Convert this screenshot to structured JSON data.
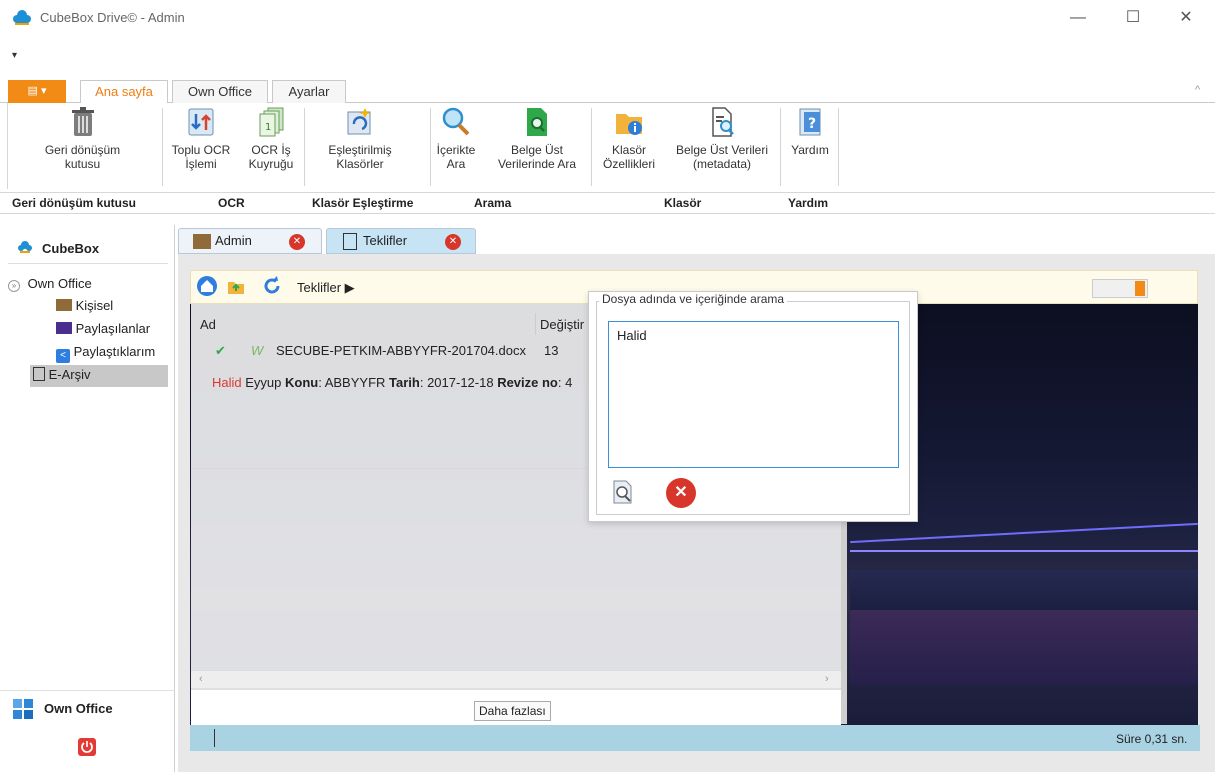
{
  "window": {
    "title": "CubeBox Drive©  -  Admin",
    "minimize": "—",
    "maximize": "☐",
    "close": "✕"
  },
  "quick_access": "▾",
  "ribbon": {
    "tabs": [
      "Ana sayfa",
      "Own Office",
      "Ayarlar"
    ],
    "active_tab": "Ana sayfa",
    "collapse": "^",
    "buttons": [
      {
        "label1": "Geri dönüşüm",
        "label2": "kutusu"
      },
      {
        "label1": "Toplu OCR",
        "label2": "İşlemi"
      },
      {
        "label1": "OCR İş",
        "label2": "Kuyruğu"
      },
      {
        "label1": "Eşleştirilmiş",
        "label2": "Klasörler"
      },
      {
        "label1": "İçerikte",
        "label2": "Ara"
      },
      {
        "label1": "Belge Üst",
        "label2": "Verilerinde Ara"
      },
      {
        "label1": "Klasör",
        "label2": "Özellikleri"
      },
      {
        "label1": "Belge Üst Verileri",
        "label2": "(metadata)"
      },
      {
        "label1": "Yardım",
        "label2": ""
      }
    ],
    "groups": [
      "Geri dönüşüm kutusu",
      "OCR",
      "Klasör Eşleştirme",
      "Arama",
      "Klasör",
      "Yardım"
    ]
  },
  "leftnav": {
    "header": "CubeBox",
    "root": "Own Office",
    "items": [
      "Kişisel",
      "Paylaşılanlar",
      "Paylaştıklarım",
      "E-Arşiv"
    ],
    "bottom_label": "Own Office"
  },
  "doc_tabs": [
    "Admin",
    "Teklifler"
  ],
  "path": {
    "current": "Teklifler ▶"
  },
  "list": {
    "col_name": "Ad",
    "col_modified": "Değiştir",
    "rows": [
      {
        "name": "SECUBE-PETKIM-ABBYYFR-201704.docx",
        "modified": "13"
      }
    ],
    "preview": {
      "highlight": "Halid",
      "rest1": " Eyyup ",
      "konu_label": "Konu",
      "konu_value": ": ABBYYFR ",
      "tarih_label": "Tarih",
      "tarih_value": ": 2017-12-18 ",
      "revize_label": "Revize no",
      "revize_value": ": 4"
    },
    "more_button": "Daha fazlası"
  },
  "search_popup": {
    "title": "Dosya adında ve içeriğinde arama",
    "value": "Halid"
  },
  "status": {
    "time": "Süre 0,31 sn."
  },
  "colors": {
    "accent": "#f07d12",
    "status_bar": "#a9d3e3",
    "toolbar_bg": "#fffbea"
  }
}
